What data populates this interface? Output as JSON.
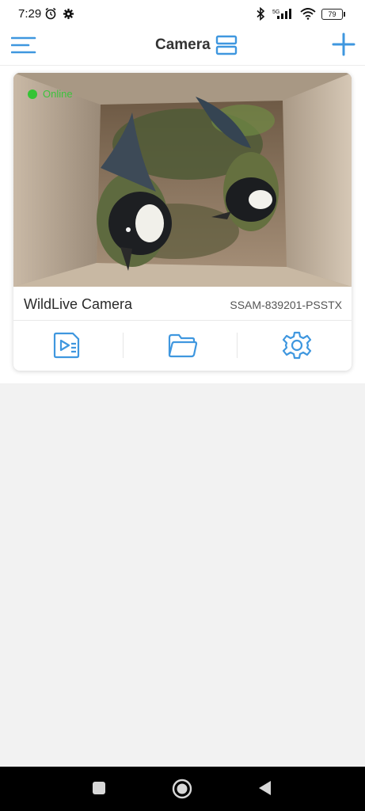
{
  "status_bar": {
    "time": "7:29",
    "network": "5G",
    "battery": "79"
  },
  "header": {
    "title": "Camera"
  },
  "colors": {
    "accent": "#3f97df",
    "online": "#35c435",
    "background": "#f2f2f2"
  },
  "camera": {
    "status": "Online",
    "name": "WildLive Camera",
    "id": "SSAM-839201-PSSTX",
    "preview_description_icon": "camera-preview-image"
  },
  "actions": [
    {
      "icon": "video-list-icon"
    },
    {
      "icon": "folder-icon"
    },
    {
      "icon": "gear-icon"
    }
  ],
  "nav": {
    "recents_icon": "square-icon",
    "home_icon": "circle-icon",
    "back_icon": "triangle-back-icon"
  }
}
